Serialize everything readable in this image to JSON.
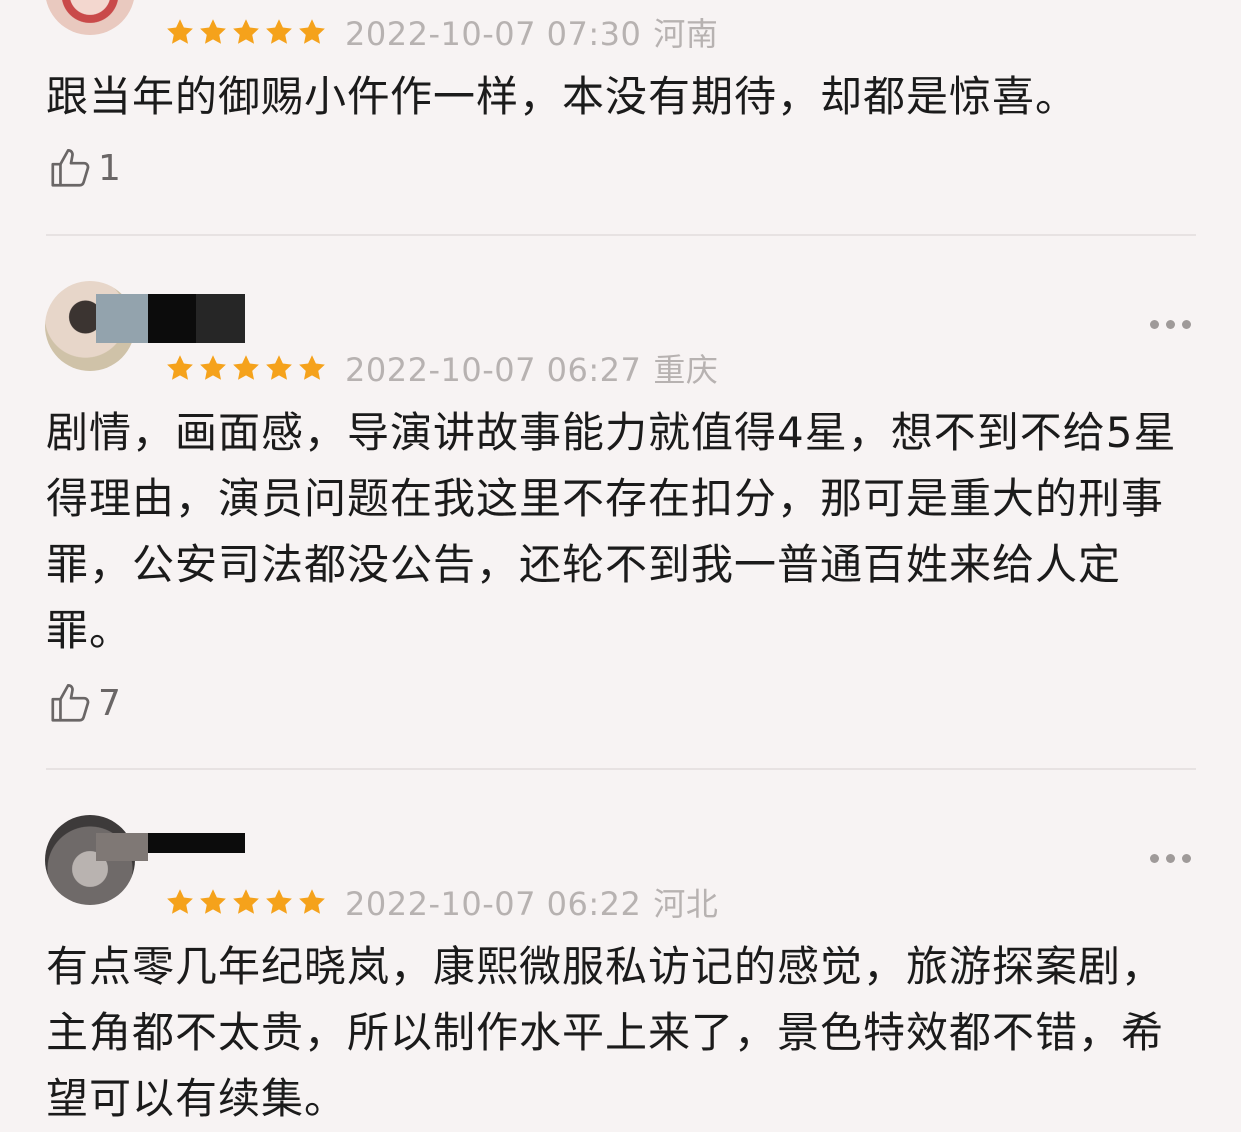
{
  "reviews": [
    {
      "rating": 5,
      "date": "2022-10-07 07:30",
      "location": "河南",
      "content": "跟当年的御赐小仵作一样，本没有期待，却都是惊喜。",
      "likes": "1"
    },
    {
      "rating": 5,
      "date": "2022-10-07 06:27",
      "location": "重庆",
      "content": "剧情，画面感，导演讲故事能力就值得4星，想不到不给5星得理由，演员问题在我这里不存在扣分，那可是重大的刑事罪，公安司法都没公告，还轮不到我一普通百姓来给人定罪。",
      "likes": "7"
    },
    {
      "rating": 5,
      "date": "2022-10-07 06:22",
      "location": "河北",
      "content": "有点零几年纪晓岚，康熙微服私访记的感觉，旅游探案剧，主角都不太贵，所以制作水平上来了，景色特效都不错，希望可以有续集。"
    }
  ],
  "icons": {
    "star": "star-icon",
    "like": "thumbs-up-icon",
    "more": "more-icon"
  },
  "colors": {
    "star": "#f5a21b",
    "meta_text": "#b7b2b1",
    "background": "#f7f3f3",
    "body_text": "#1b1b1b"
  }
}
